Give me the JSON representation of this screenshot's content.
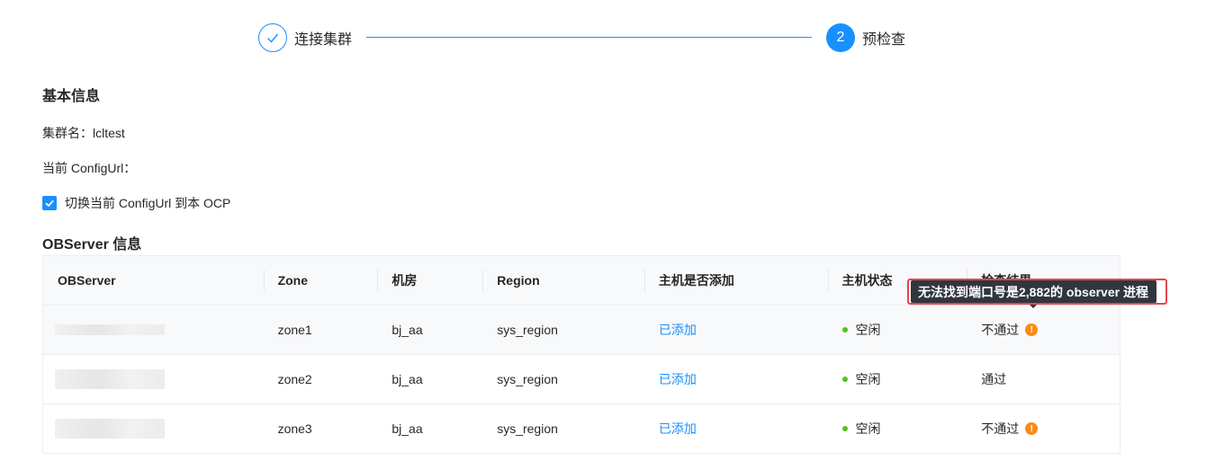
{
  "steps": [
    {
      "title": "连接集群",
      "status": "done"
    },
    {
      "number": "2",
      "title": "预检查",
      "status": "active"
    }
  ],
  "basic_info": {
    "title": "基本信息",
    "cluster_name_label": "集群名：",
    "cluster_name_value": "lcltest",
    "config_url_label": "当前 ConfigUrl：",
    "config_url_value": "",
    "checkbox_label": "切换当前 ConfigUrl 到本 OCP",
    "checkbox_checked": true
  },
  "observer_info": {
    "title": "OBServer 信息",
    "columns": [
      "OBServer",
      "Zone",
      "机房",
      "Region",
      "主机是否添加",
      "主机状态",
      "检查结果"
    ],
    "rows": [
      {
        "observer": "",
        "zone": "zone1",
        "idc": "bj_aa",
        "region": "sys_region",
        "added": "已添加",
        "host_status": "空闲",
        "result": "不通过",
        "warn": true
      },
      {
        "observer": "",
        "zone": "zone2",
        "idc": "bj_aa",
        "region": "sys_region",
        "added": "已添加",
        "host_status": "空闲",
        "result": "通过",
        "warn": false
      },
      {
        "observer": "",
        "zone": "zone3",
        "idc": "bj_aa",
        "region": "sys_region",
        "added": "已添加",
        "host_status": "空闲",
        "result": "不通过",
        "warn": true
      }
    ]
  },
  "tooltip": {
    "text": "无法找到端口号是2,882的 observer 进程"
  },
  "colors": {
    "primary": "#1890ff",
    "success_dot": "#52c41a",
    "warning": "#fa8c16",
    "highlight": "#e5474b",
    "tooltip_bg": "#303540"
  },
  "icons": {
    "step_done": "check-icon",
    "checkbox": "check-icon",
    "warn": "exclamation-circle-icon"
  }
}
